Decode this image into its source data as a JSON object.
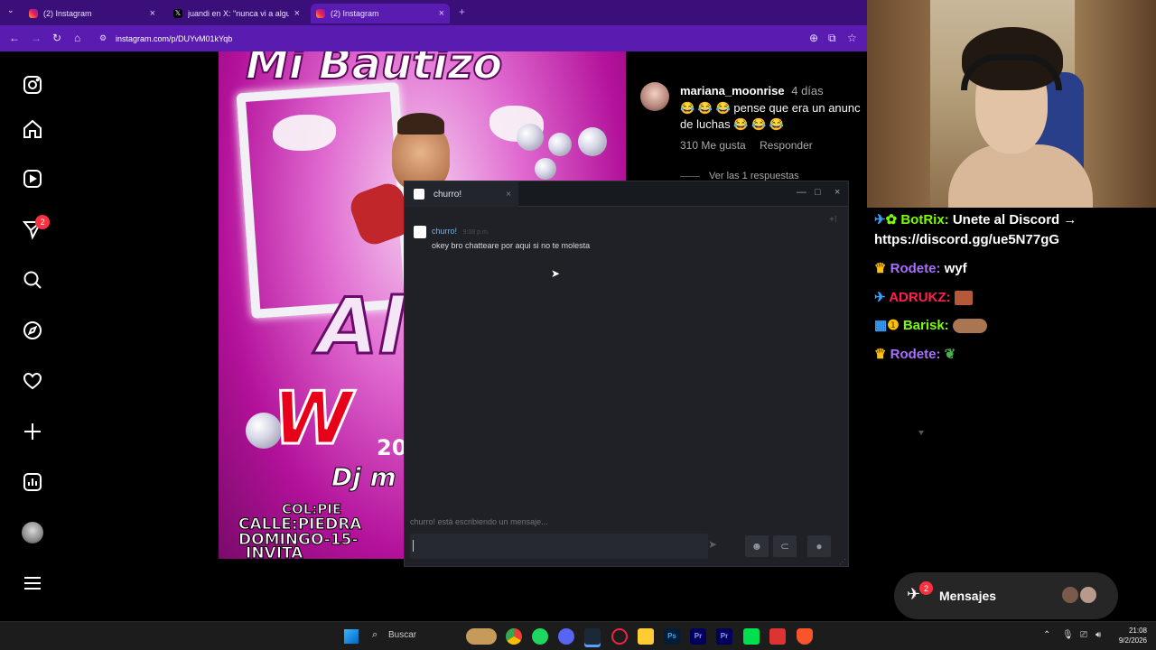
{
  "browser": {
    "tabs": [
      {
        "label": "(2) Instagram",
        "active": false
      },
      {
        "label": "juandi en X: \"nunca vi a alguien",
        "active": false
      },
      {
        "label": "(2) Instagram",
        "active": true
      }
    ],
    "new_tab": "+",
    "url": "instagram.com/p/DUYvM01kYqb"
  },
  "sidebar": {
    "icons": [
      "instagram-logo-icon",
      "home-icon",
      "reels-icon",
      "direct-messages-icon",
      "search-icon",
      "explore-icon",
      "heart-icon",
      "create-icon",
      "dashboard-icon",
      "profile-avatar",
      "menu-icon"
    ],
    "notification_count": "2"
  },
  "post": {
    "flyer_lines": [
      "Mi Bautizo",
      "Al",
      "W",
      "20",
      "Dj m",
      "COL:PIE",
      "CALLE:PIEDRA",
      "DOMINGO-15-",
      "INVITA"
    ]
  },
  "comments": {
    "comment": {
      "username": "mariana_moonrise",
      "time": "4 días",
      "text": "😂 😂 😂 pense que era un anunc de luchas 😂 😂 😂",
      "likes": "310 Me gusta",
      "reply": "Responder"
    },
    "view_replies": "Ver las 1 respuestas"
  },
  "chat_window": {
    "tab_title": "churro!",
    "messages": [
      {
        "author": "churro!",
        "time": "9:08 p.m.",
        "text": "okey bro chatteare por aqui si no te molesta"
      }
    ],
    "typing_indicator": "churro! está escribiendo un mensaje...",
    "composer_value": ""
  },
  "twitch_chat": [
    {
      "user": "BotRix:",
      "text": " Unete al Discord →",
      "color": "#7CFC00"
    },
    {
      "user": "",
      "text": "https://discord.gg/ue5N77gG",
      "color": "#ffffff"
    },
    {
      "user": "Rodete:",
      "text": " wyf",
      "color": "#a970ff"
    },
    {
      "user": "ADRUKZ:",
      "text": "",
      "color": "#ff2050"
    },
    {
      "user": "Barisk:",
      "text": "",
      "color": "#7CFC00"
    },
    {
      "user": "Rodete:",
      "text": "",
      "color": "#a970ff"
    }
  ],
  "messages_pill": {
    "label": "Mensajes",
    "count": "2"
  },
  "taskbar": {
    "search_label": "Buscar",
    "time": "21:08",
    "date": "9/2/2026"
  }
}
